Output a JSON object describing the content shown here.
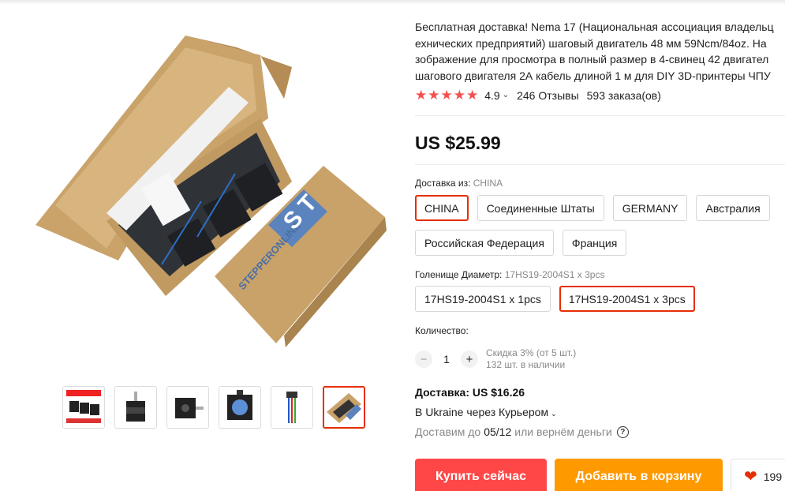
{
  "product": {
    "title_lines": [
      "Бесплатная доставка! Nema 17 (Национальная ассоциация владельц",
      "ехнических предприятий) шаговый двигатель 48 мм 59Ncm/84oz. На",
      "зображение для просмотра в полный размер в 4-свинец 42 двигател",
      "шагового двигателя 2А кабель длиной 1 м для DIY 3D-принтеры ЧПУ"
    ],
    "rating": "4.9",
    "reviews": "246 Отзывы",
    "orders": "593 заказа(ов)",
    "price": "US $25.99"
  },
  "gallery": {
    "box_brand": "STEPPERONLINE",
    "box_logo": "S T",
    "thumbnails": [
      "three-motors",
      "motor-front",
      "motor-side",
      "motor-back",
      "connector-cable",
      "boxed-set"
    ]
  },
  "shipping_from": {
    "label": "Доставка из:",
    "selected": "CHINA",
    "options": [
      "CHINA",
      "Соединенные Штаты",
      "GERMANY",
      "Австралия",
      "Российская Федерация",
      "Франция"
    ]
  },
  "variant": {
    "label": "Голенище Диаметр:",
    "selected": "17HS19-2004S1 x 3pcs",
    "options": [
      "17HS19-2004S1 x 1pcs",
      "17HS19-2004S1 x 3pcs"
    ]
  },
  "quantity": {
    "label": "Количество:",
    "value": "1",
    "minus": "−",
    "plus": "+",
    "discount": "Скидка 3% (от 5 шт.)",
    "stock": "132 шт. в наличии"
  },
  "delivery": {
    "title": "Доставка: US $16.26",
    "to": "В Ukraine через Курьером",
    "promise_prefix": "Доставим до",
    "promise_date": "05/12",
    "promise_suffix": "или вернём деньги",
    "help_icon": "?"
  },
  "actions": {
    "buy_now": "Купить сейчас",
    "add_to_cart": "Добавить в корзину",
    "wishlist_count": "199"
  },
  "colors": {
    "accent": "#e62e04",
    "buy": "#ff4747",
    "cart": "#ff9900",
    "star": "#f34f4f"
  }
}
